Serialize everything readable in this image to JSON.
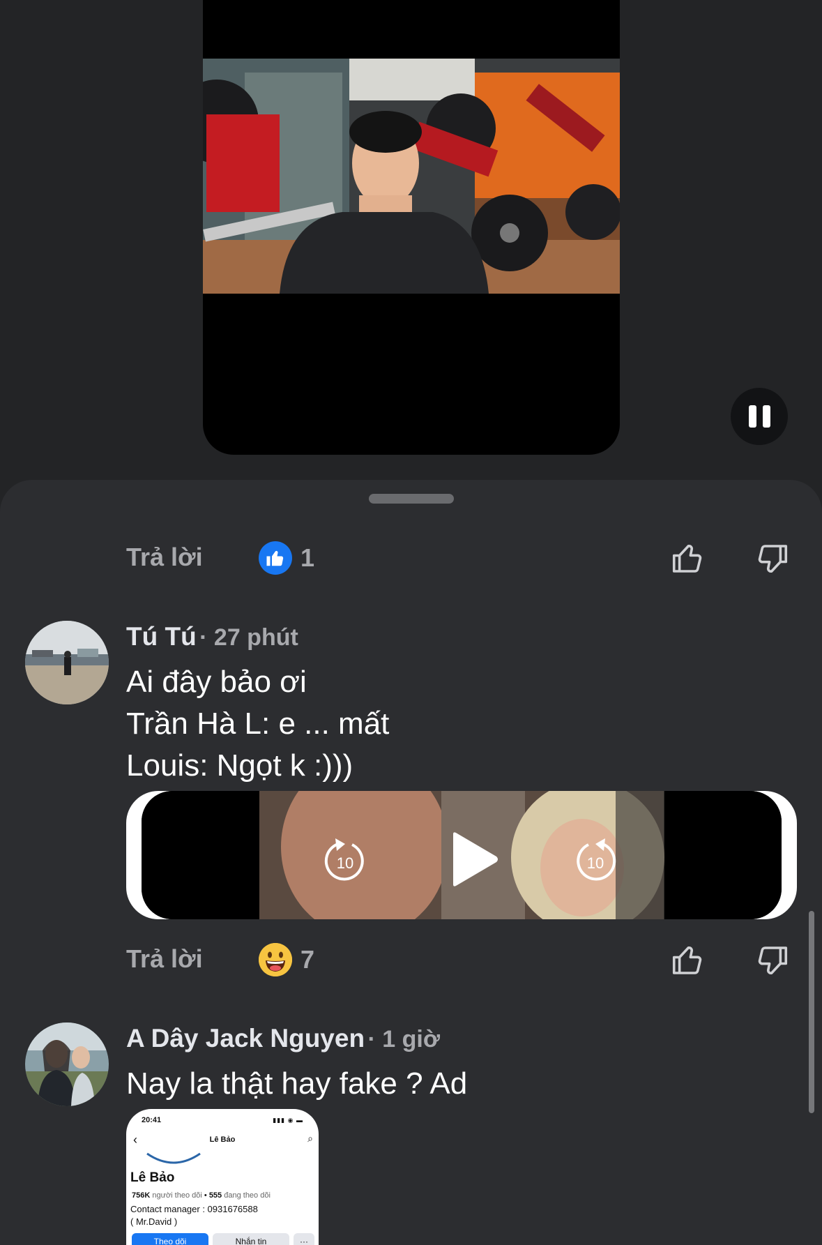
{
  "player": {
    "pause_icon": "pause-icon"
  },
  "comments": [
    {
      "reply_label": "Trả lời",
      "reaction": {
        "icon": "like-reaction-icon",
        "count": "1"
      }
    },
    {
      "author": "Tú Tú",
      "time": "· 27 phút",
      "lines": [
        "Ai đây bảo ơi",
        "Trần Hà L: e ... mất",
        "Louis: Ngọt k :)))"
      ],
      "media": {
        "rewind_label": "10",
        "forward_label": "10"
      },
      "reply_label": "Trả lời",
      "reaction": {
        "icon": "grinning-emoji-icon",
        "count": "7"
      }
    },
    {
      "author": "A Dây Jack Nguyen",
      "time": "· 1 giờ",
      "lines": [
        "Nay la thật hay fake ? Ad"
      ],
      "attached_screenshot": {
        "status_time": "20:41",
        "title": "Lê Bảo",
        "name": "Lê Bảo",
        "followers_count": "756K",
        "followers_label": "người theo dõi",
        "following_count": "555",
        "following_label": "đang theo dõi",
        "contact": "Contact manager : 0931676588",
        "contact_note": "( Mr.David )",
        "follow_label": "Theo dõi",
        "message_label": "Nhắn tin",
        "more_label": "···"
      }
    }
  ],
  "colors": {
    "sheet_bg": "#2c2d30",
    "page_bg": "#232426",
    "like_blue": "#1877f2",
    "muted_text": "#a8a9ad"
  }
}
